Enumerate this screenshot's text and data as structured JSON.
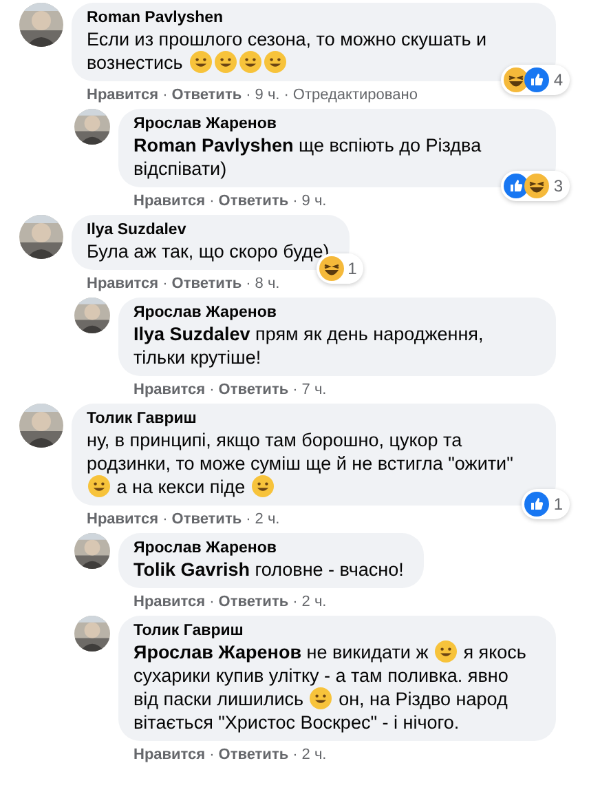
{
  "separator": "·",
  "comments": [
    {
      "author": "Roman Pavlyshen",
      "reply": false,
      "message": [
        {
          "kind": "text",
          "text": "Если из прошлого сезона, то можно скушать и вознестись "
        },
        {
          "kind": "emoji"
        },
        {
          "kind": "emoji"
        },
        {
          "kind": "emoji"
        },
        {
          "kind": "emoji"
        }
      ],
      "reactions": [
        {
          "kind": "haha"
        },
        {
          "kind": "like"
        }
      ],
      "reaction_count": "4",
      "like": "Нравится",
      "answer": "Ответить",
      "time": "9 ч.",
      "edited": "Отредактировано"
    },
    {
      "author": "Ярослав Жаренов",
      "reply": true,
      "message": [
        {
          "kind": "mention",
          "text": "Roman Pavlyshen"
        },
        {
          "kind": "text",
          "text": " ще вспіють до Різдва відспівати)"
        }
      ],
      "reactions": [
        {
          "kind": "like"
        },
        {
          "kind": "haha"
        }
      ],
      "reaction_count": "3",
      "like": "Нравится",
      "answer": "Ответить",
      "time": "9 ч."
    },
    {
      "author": "Ilya Suzdalev",
      "reply": false,
      "message": [
        {
          "kind": "text",
          "text": "Була аж так, що скоро буде)"
        }
      ],
      "reactions": [
        {
          "kind": "haha"
        }
      ],
      "reaction_count": "1",
      "like": "Нравится",
      "answer": "Ответить",
      "time": "8 ч."
    },
    {
      "author": "Ярослав Жаренов",
      "reply": true,
      "message": [
        {
          "kind": "mention",
          "text": "Ilya Suzdalev"
        },
        {
          "kind": "text",
          "text": " прям як день народження, тільки крутіше!"
        }
      ],
      "like": "Нравится",
      "answer": "Ответить",
      "time": "7 ч."
    },
    {
      "author": "Толик Гавриш",
      "reply": false,
      "message": [
        {
          "kind": "text",
          "text": "ну, в принципі, якщо там борошно, цукор та родзинки, то може суміш ще й не встигла \"ожити\" "
        },
        {
          "kind": "emoji"
        },
        {
          "kind": "text",
          "text": " а на кекси піде "
        },
        {
          "kind": "emoji"
        }
      ],
      "reactions": [
        {
          "kind": "like"
        }
      ],
      "reaction_count": "1",
      "like": "Нравится",
      "answer": "Ответить",
      "time": "2 ч."
    },
    {
      "author": "Ярослав Жаренов",
      "reply": true,
      "message": [
        {
          "kind": "mention",
          "text": "Tolik Gavrish"
        },
        {
          "kind": "text",
          "text": " головне - вчасно!"
        }
      ],
      "like": "Нравится",
      "answer": "Ответить",
      "time": "2 ч."
    },
    {
      "author": "Толик Гавриш",
      "reply": true,
      "message": [
        {
          "kind": "mention",
          "text": "Ярослав Жаренов"
        },
        {
          "kind": "text",
          "text": " не викидати ж "
        },
        {
          "kind": "emoji"
        },
        {
          "kind": "text",
          "text": " я якось сухарики купив улітку - а там поливка. явно від паски лишились "
        },
        {
          "kind": "emoji"
        },
        {
          "kind": "text",
          "text": " он, на Різдво народ вітається \"Христос Воскрес\" - і нічого."
        }
      ],
      "like": "Нравится",
      "answer": "Ответить",
      "time": "2 ч."
    }
  ]
}
